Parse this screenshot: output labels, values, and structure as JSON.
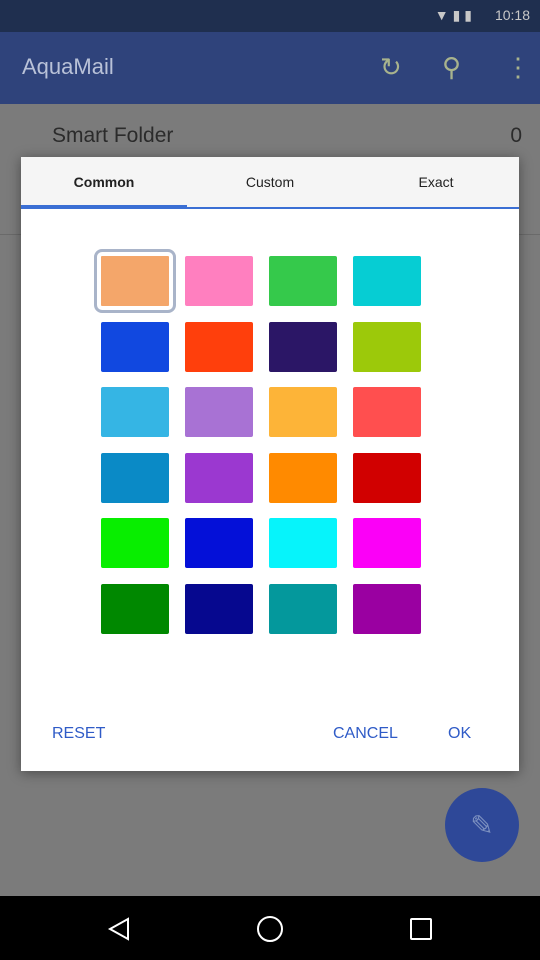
{
  "status": {
    "time": "10:18"
  },
  "app": {
    "title": "AquaMail"
  },
  "list": {
    "smart_folder_label": "Smart Folder",
    "smart_folder_count": "0"
  },
  "dialog": {
    "tabs": [
      {
        "label": "Common"
      },
      {
        "label": "Custom"
      },
      {
        "label": "Exact"
      }
    ],
    "active_tab": "Common",
    "swatches": [
      "#f4a66a",
      "#ff7fbf",
      "#35c94b",
      "#06cdd3",
      "#1148e0",
      "#ff3f0c",
      "#2b1666",
      "#9cc90a",
      "#35b5e4",
      "#a872d4",
      "#fdb438",
      "#ff4f4f",
      "#0a8ac6",
      "#9b38d0",
      "#ff8a00",
      "#d10000",
      "#08ee00",
      "#0410d8",
      "#06f4fb",
      "#fb00f7",
      "#008800",
      "#06088f",
      "#04989c",
      "#9a00a1"
    ],
    "selected_swatch_index": 0,
    "reset_label": "Reset",
    "cancel_label": "Cancel",
    "ok_label": "OK"
  }
}
